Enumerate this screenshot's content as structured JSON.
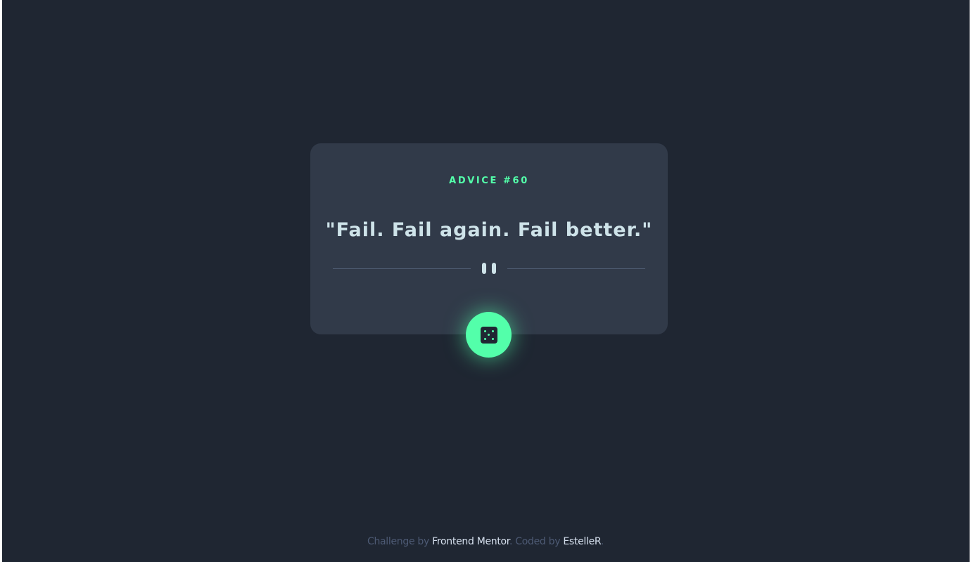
{
  "card": {
    "advice_label": "ADVICE #60",
    "advice_text": "\"Fail. Fail again. Fail better.\"",
    "divider_icon": "pause-icon"
  },
  "dice_button": {
    "icon": "dice-icon",
    "color": "#53ffaa"
  },
  "footer": {
    "prefix": "Challenge by ",
    "challenge_link": "Frontend Mentor",
    "middle": ". Coded by ",
    "author_link": "EstelleR",
    "suffix": "."
  },
  "colors": {
    "background": "#1f2632",
    "card": "#313a49",
    "accent": "#53ffaa",
    "text": "#cee3e9",
    "muted": "#4d5a74"
  }
}
